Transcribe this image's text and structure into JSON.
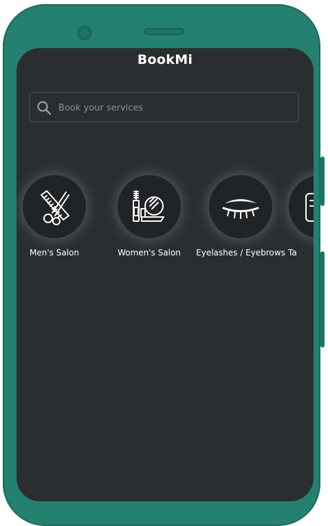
{
  "app": {
    "title": "BookMi"
  },
  "search": {
    "placeholder": "Book your services"
  },
  "categories": [
    {
      "label": "Men's Salon",
      "icon": "scissors-comb-icon"
    },
    {
      "label": "Women's Salon",
      "icon": "mirror-mascara-icon"
    },
    {
      "label": "Eyelashes / Eyebrows",
      "icon": "closed-eye-lashes-icon"
    },
    {
      "label": "Ta",
      "icon": "tattoo-icon"
    }
  ],
  "colors": {
    "phone_body": "#24806f",
    "screen_bg": "#2b2e31",
    "text": "#ffffff"
  }
}
